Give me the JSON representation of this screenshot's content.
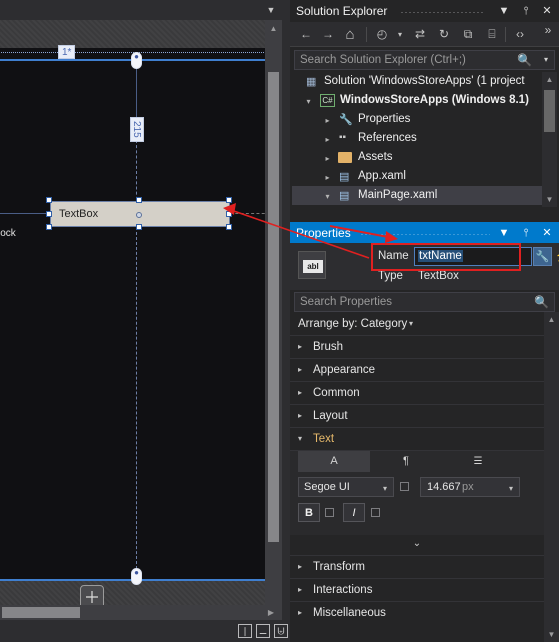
{
  "designer": {
    "dropdown_icon": "chevron-down-icon",
    "guides": {
      "row_label": "1*",
      "vertical_measure": "215"
    },
    "textbox": {
      "label": "TextBox"
    },
    "textblock": {
      "label": "extBlock"
    },
    "app_icon": "windows-logo-icon",
    "statusbar": {
      "buttons": [
        {
          "name": "view-split-vertical",
          "glyph": "❘"
        },
        {
          "name": "view-collapse-pane",
          "glyph": "➖"
        },
        {
          "name": "view-design-xaml-swap",
          "glyph": "⨄"
        }
      ]
    },
    "scroll_right_glyph": "▶"
  },
  "solution_explorer": {
    "title": "Solution Explorer",
    "title_buttons": [
      {
        "name": "window-dropdown",
        "glyph": "▼"
      },
      {
        "name": "pin",
        "glyph": "⫯"
      },
      {
        "name": "close",
        "glyph": "✕"
      }
    ],
    "toolbar": [
      {
        "name": "back",
        "glyph": "←"
      },
      {
        "name": "forward",
        "glyph": "→"
      },
      {
        "name": "home",
        "glyph": "⌂"
      },
      {
        "name": "pending-changes-filter",
        "glyph": "◴"
      },
      {
        "name": "filter-dropdown",
        "glyph": "▾"
      },
      {
        "name": "sync-with-active-document",
        "glyph": "⇄"
      },
      {
        "name": "refresh",
        "glyph": "↻"
      },
      {
        "name": "collapse-all",
        "glyph": "⧉"
      },
      {
        "name": "show-all-files",
        "glyph": "⌸"
      },
      {
        "name": "view-code",
        "glyph": "‹›"
      },
      {
        "name": "toolbar-overflow",
        "glyph": "»"
      }
    ],
    "search": {
      "placeholder": "Search Solution Explorer (Ctrl+;)",
      "icon": "search-icon",
      "dropdown": "▾"
    },
    "tree": [
      {
        "indent": 0,
        "arrow": "",
        "icon": "solution-icon",
        "icon_glyph": "▣",
        "label": "Solution 'WindowsStoreApps' (1 project",
        "bold": false,
        "selected": false
      },
      {
        "indent": 14,
        "arrow": "▾",
        "icon": "csharp-project-icon",
        "icon_glyph": "C#",
        "label": "WindowsStoreApps (Windows 8.1)",
        "bold": true,
        "selected": false
      },
      {
        "indent": 32,
        "arrow": "▸",
        "icon": "properties-wrench-icon",
        "icon_glyph": "🔧",
        "label": "Properties",
        "bold": false,
        "selected": false
      },
      {
        "indent": 32,
        "arrow": "▸",
        "icon": "references-icon",
        "icon_glyph": "▫",
        "label": "References",
        "bold": false,
        "selected": false
      },
      {
        "indent": 32,
        "arrow": "▸",
        "icon": "folder-icon",
        "icon_glyph": "📁",
        "label": "Assets",
        "bold": false,
        "selected": false
      },
      {
        "indent": 32,
        "arrow": "▸",
        "icon": "xaml-file-icon",
        "icon_glyph": "▤",
        "label": "App.xaml",
        "bold": false,
        "selected": false
      },
      {
        "indent": 32,
        "arrow": "▾",
        "icon": "xaml-file-icon",
        "icon_glyph": "▤",
        "label": "MainPage.xaml",
        "bold": false,
        "selected": true
      }
    ]
  },
  "properties": {
    "title": "Properties",
    "title_buttons": [
      {
        "name": "window-dropdown",
        "glyph": "▼"
      },
      {
        "name": "pin",
        "glyph": "⫯"
      },
      {
        "name": "close",
        "glyph": "✕"
      }
    ],
    "element_icon": "abl-textbox-icon",
    "element_icon_text": "abl",
    "name_label": "Name",
    "name_value": "txtName",
    "name_wrench_icon": "wrench-icon",
    "name_events_icon": "lightning-bolt-icon",
    "type_label": "Type",
    "type_value": "TextBox",
    "search": {
      "placeholder": "Search Properties",
      "icon": "search-icon"
    },
    "arrange_by": "Arrange by: Category",
    "arrange_dropdown": "▾",
    "categories_top": [
      {
        "name": "Brush",
        "expanded": false,
        "arrow": "▸"
      },
      {
        "name": "Appearance",
        "expanded": false,
        "arrow": "▸"
      },
      {
        "name": "Common",
        "expanded": false,
        "arrow": "▸"
      },
      {
        "name": "Layout",
        "expanded": false,
        "arrow": "▸"
      },
      {
        "name": "Text",
        "expanded": true,
        "arrow": "▾"
      }
    ],
    "text_section": {
      "tabs": [
        {
          "name": "character-tab",
          "glyph": "A",
          "selected": true
        },
        {
          "name": "paragraph-tab",
          "glyph": "¶",
          "selected": false
        },
        {
          "name": "list-indent-tab",
          "glyph": "☰",
          "selected": false
        }
      ],
      "font_family": "Segoe UI",
      "font_family_dropdown": "▾",
      "font_size": "14.667",
      "font_size_unit": "px",
      "font_size_dropdown": "▾",
      "bold_label": "B",
      "italic_label": "I",
      "expander_glyph": "⌄"
    },
    "categories_bottom": [
      {
        "name": "Transform",
        "expanded": false,
        "arrow": "▸"
      },
      {
        "name": "Interactions",
        "expanded": false,
        "arrow": "▸"
      },
      {
        "name": "Miscellaneous",
        "expanded": false,
        "arrow": "▸"
      }
    ]
  },
  "annotation": {
    "color": "#e02020",
    "shape": "red-rectangle-and-arrow"
  }
}
